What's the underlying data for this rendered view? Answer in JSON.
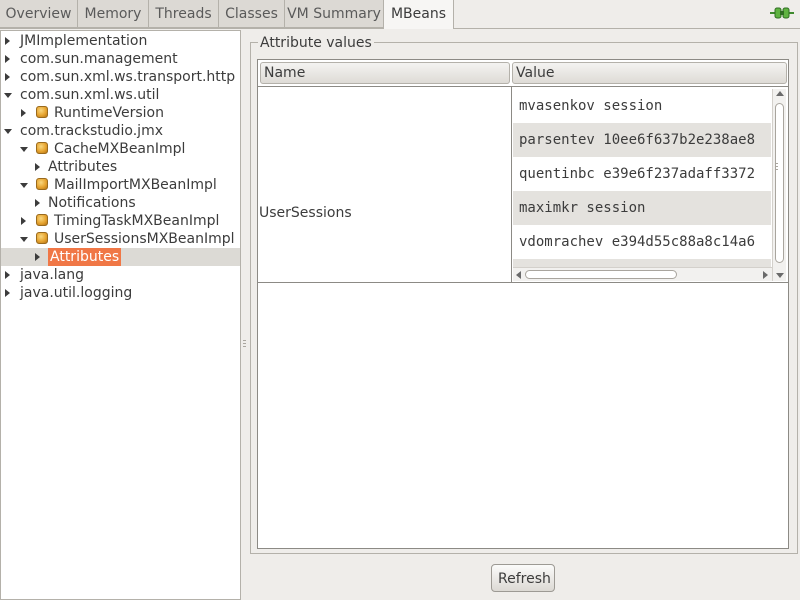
{
  "tabs": [
    {
      "label": "Overview",
      "active": false
    },
    {
      "label": "Memory",
      "active": false
    },
    {
      "label": "Threads",
      "active": false
    },
    {
      "label": "Classes",
      "active": false
    },
    {
      "label": "VM Summary",
      "active": false
    },
    {
      "label": "MBeans",
      "active": true
    }
  ],
  "connection_icon": "plug-connected-icon",
  "tree": {
    "nodes": [
      {
        "label": "JMImplementation",
        "icon": null,
        "expanded": false
      },
      {
        "label": "com.sun.management",
        "icon": null,
        "expanded": false
      },
      {
        "label": "com.sun.xml.ws.transport.http",
        "icon": null,
        "expanded": false
      },
      {
        "label": "com.sun.xml.ws.util",
        "icon": null,
        "expanded": true
      },
      {
        "label": "RuntimeVersion",
        "icon": "mbean-icon",
        "expanded": false
      },
      {
        "label": "com.trackstudio.jmx",
        "icon": null,
        "expanded": true
      },
      {
        "label": "CacheMXBeanImpl",
        "icon": "mbean-icon",
        "expanded": true
      },
      {
        "label": "Attributes",
        "icon": null,
        "expanded": false
      },
      {
        "label": "MailImportMXBeanImpl",
        "icon": "mbean-icon",
        "expanded": true
      },
      {
        "label": "Notifications",
        "icon": null,
        "expanded": false
      },
      {
        "label": "TimingTaskMXBeanImpl",
        "icon": "mbean-icon",
        "expanded": false
      },
      {
        "label": "UserSessionsMXBeanImpl",
        "icon": "mbean-icon",
        "expanded": true
      },
      {
        "label": "Attributes",
        "icon": null,
        "expanded": false,
        "selected": true
      },
      {
        "label": "java.lang",
        "icon": null,
        "expanded": false
      },
      {
        "label": "java.util.logging",
        "icon": null,
        "expanded": false
      }
    ]
  },
  "attributes": {
    "group_title": "Attribute values",
    "columns": [
      "Name",
      "Value"
    ],
    "row_name": "UserSessions",
    "values": [
      "mvasenkov session",
      "parsentev 10ee6f637b2e238ae8",
      "quentinbc e39e6f237adaff3372",
      "maximkr session",
      "vdomrachev e394d55c88a8c14a6"
    ]
  },
  "refresh_label": "Refresh",
  "colors": {
    "selection": "#f07746",
    "window_bg": "#efedea",
    "alt_row": "#e4e2de"
  }
}
